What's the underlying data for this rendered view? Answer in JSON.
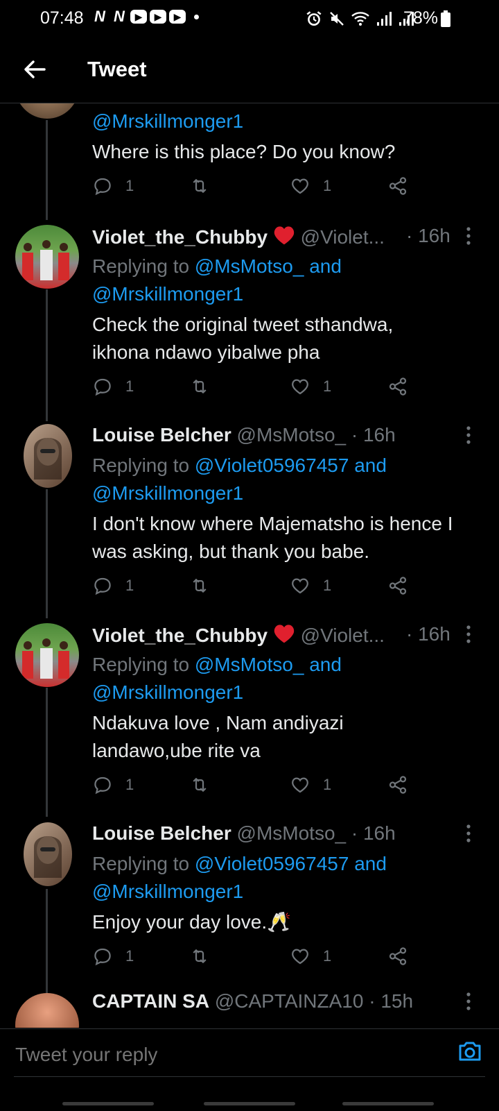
{
  "status_bar": {
    "time": "07:48",
    "notif_icons": [
      "N",
      "N",
      "▶",
      "▶",
      "▶"
    ],
    "battery_text": "78%"
  },
  "header": {
    "title": "Tweet"
  },
  "thread": {
    "partial_tweet": {
      "reply_mention": "@Mrskillmonger1",
      "text": "Where is this place? Do you know?",
      "reply_count": "1",
      "like_count": "1"
    },
    "tweets": [
      {
        "name": "Violet_the_Chubby",
        "handle": "@Violet...",
        "time": "· 16h",
        "replying_prefix": "Replying to",
        "mention_1": "@MsMotso_ and",
        "mention_2": "@Mrskillmonger1",
        "text": "Check the original tweet sthandwa, ikhona ndawo yibalwe pha",
        "reply_count": "1",
        "like_count": "1"
      },
      {
        "name": "Louise Belcher",
        "handle": "@MsMotso_",
        "time": "· 16h",
        "replying_prefix": "Replying to",
        "mention_1": "@Violet05967457 and",
        "mention_2": "@Mrskillmonger1",
        "text": "I don't know where Majematsho is hence I was asking, but thank you babe.",
        "reply_count": "1",
        "like_count": "1"
      },
      {
        "name": "Violet_the_Chubby",
        "handle": "@Violet...",
        "time": "· 16h",
        "replying_prefix": "Replying to",
        "mention_1": "@MsMotso_ and",
        "mention_2": "@Mrskillmonger1",
        "text": "Ndakuva love , Nam andiyazi landawo,ube rite va",
        "reply_count": "1",
        "like_count": "1"
      },
      {
        "name": "Louise Belcher",
        "handle": "@MsMotso_",
        "time": "· 16h",
        "replying_prefix": "Replying to",
        "mention_1": "@Violet05967457 and",
        "mention_2": "@Mrskillmonger1",
        "text": "Enjoy your day love.🥂",
        "reply_count": "1",
        "like_count": "1"
      },
      {
        "name": "CAPTAIN SA",
        "handle": "@CAPTAINZA10",
        "time": "· 15h"
      }
    ]
  },
  "reply_bar": {
    "placeholder": "Tweet your reply"
  },
  "colors": {
    "accent": "#1d9bf0",
    "heart": "#f91880",
    "secondary_text": "#71767b",
    "background": "#000000"
  }
}
